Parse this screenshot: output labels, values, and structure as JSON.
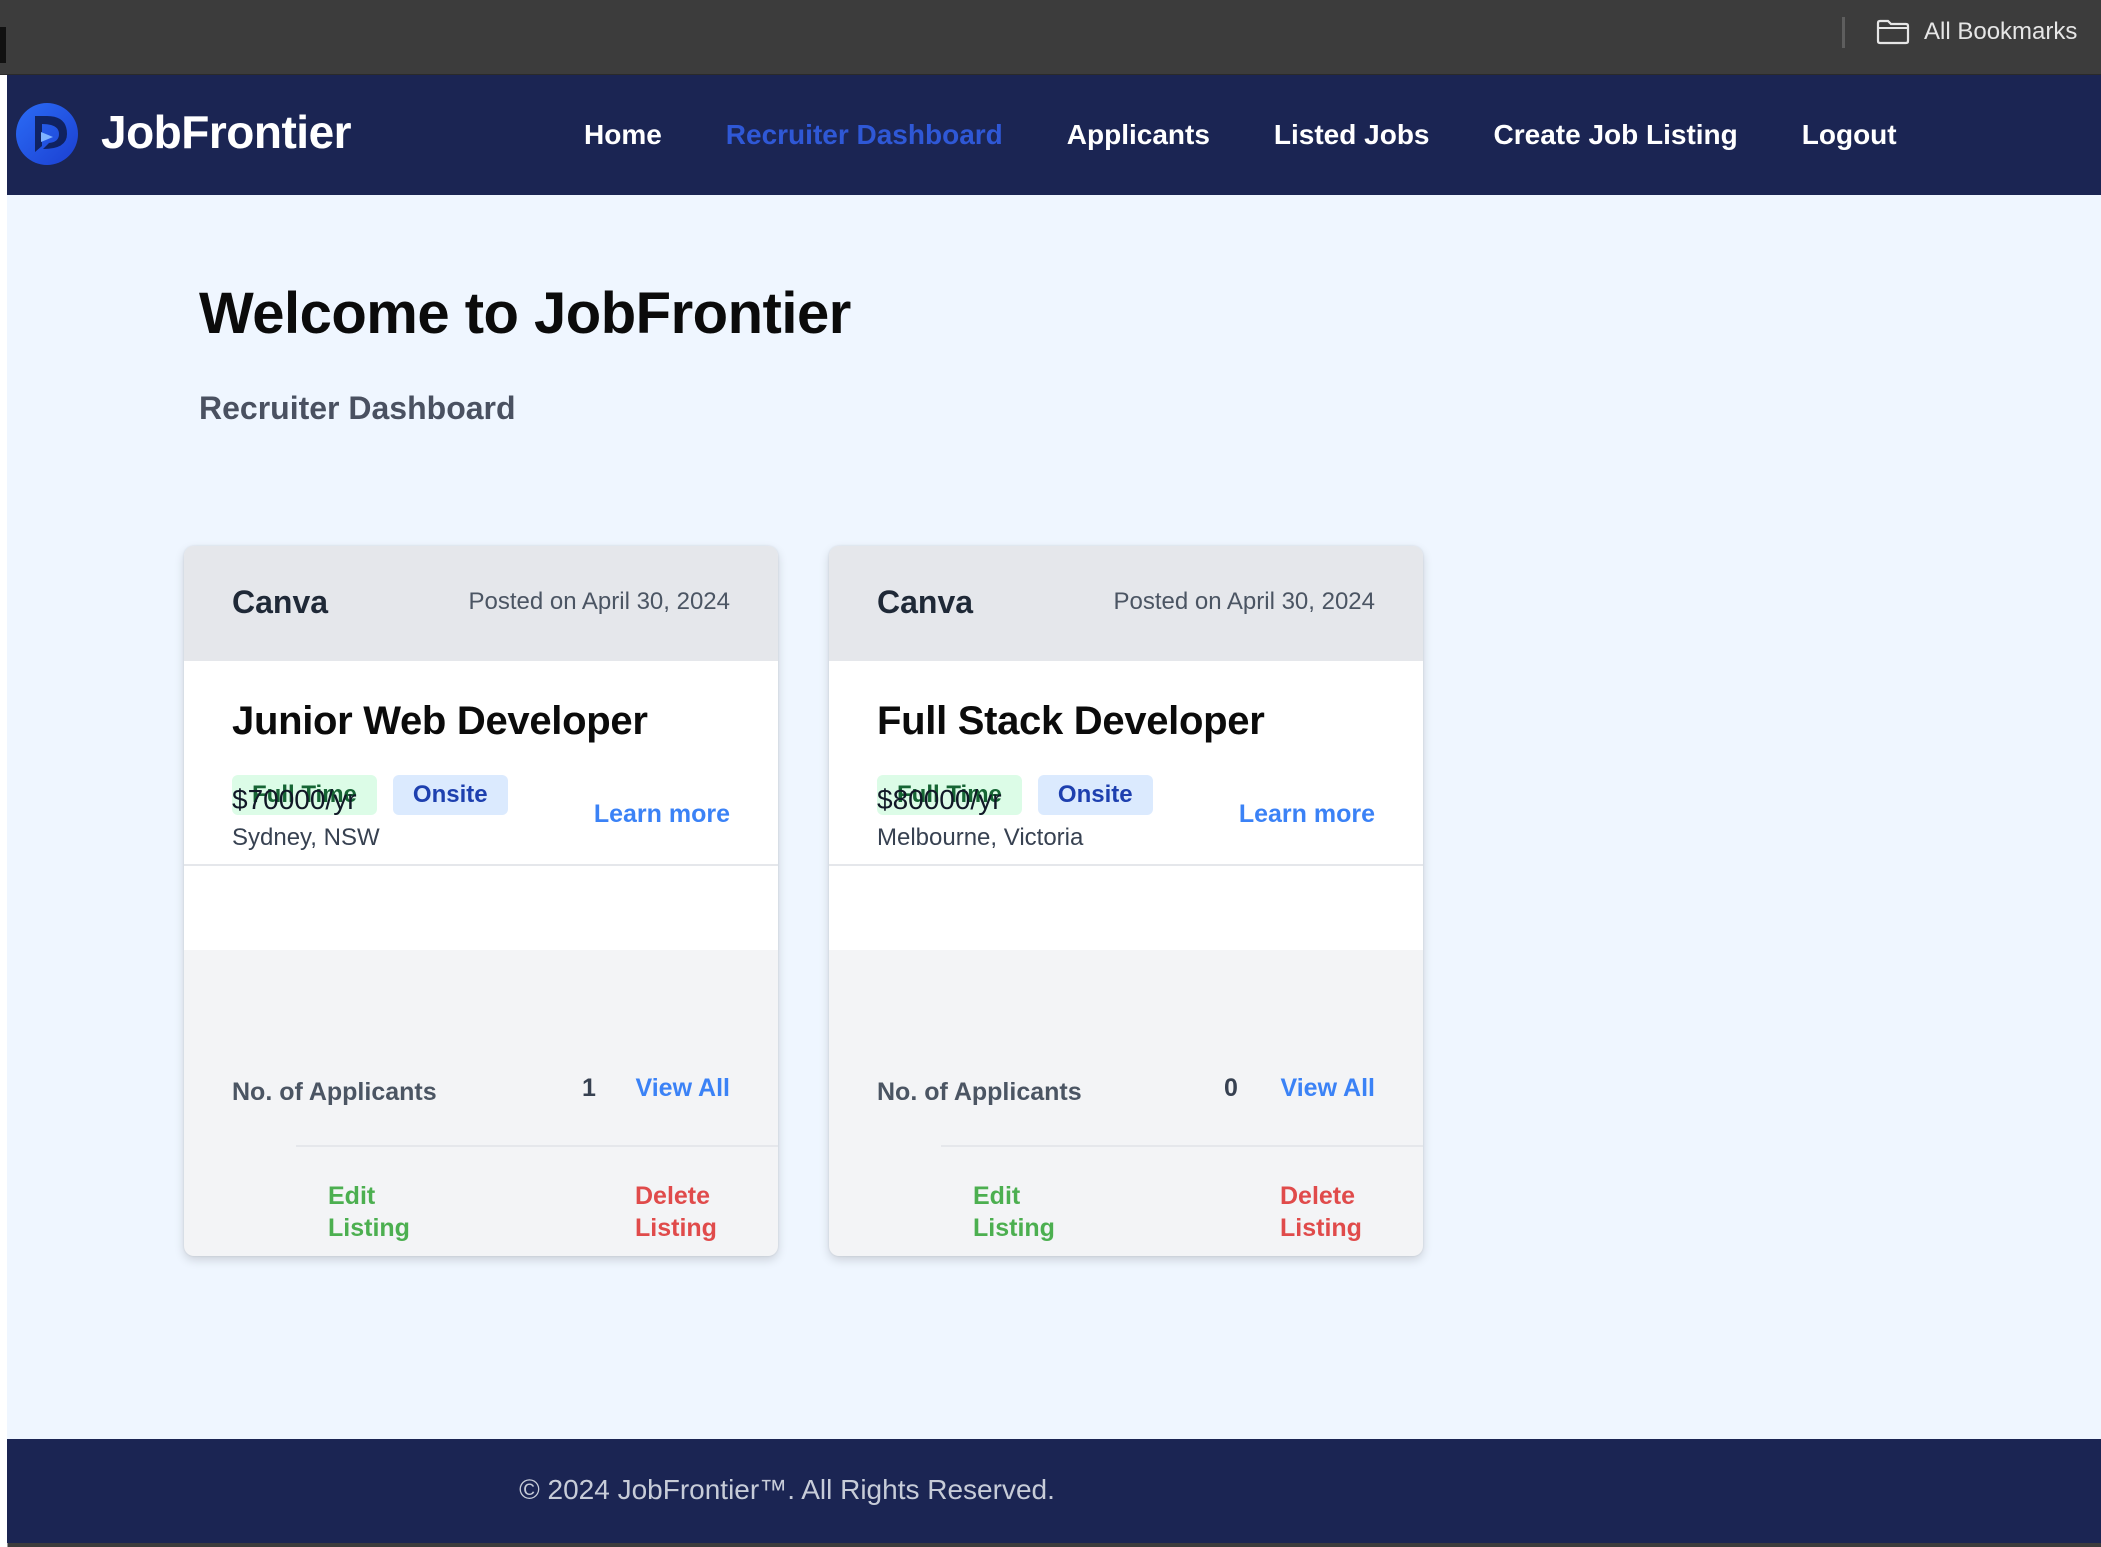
{
  "browser": {
    "bookmarks_label": "All Bookmarks"
  },
  "navbar": {
    "brand": "JobFrontier",
    "links": [
      {
        "label": "Home",
        "active": false
      },
      {
        "label": "Recruiter Dashboard",
        "active": true
      },
      {
        "label": "Applicants",
        "active": false
      },
      {
        "label": "Listed Jobs",
        "active": false
      },
      {
        "label": "Create Job Listing",
        "active": false
      },
      {
        "label": "Logout",
        "active": false
      }
    ]
  },
  "main": {
    "title": "Welcome to JobFrontier",
    "subtitle": "Recruiter Dashboard"
  },
  "jobs": [
    {
      "company": "Canva",
      "posted": "Posted on April 30, 2024",
      "title": "Junior Web Developer",
      "tags": [
        "Full Time",
        "Onsite"
      ],
      "salary": "$70000/yr",
      "location": "Sydney, NSW",
      "learn_more": "Learn more",
      "applicants_label": "No. of Applicants",
      "applicants_count": "1",
      "view_all": "View All",
      "edit": "Edit Listing",
      "delete": "Delete Listing"
    },
    {
      "company": "Canva",
      "posted": "Posted on April 30, 2024",
      "title": "Full Stack Developer",
      "tags": [
        "Full Time",
        "Onsite"
      ],
      "salary": "$80000/yr",
      "location": "Melbourne, Victoria",
      "learn_more": "Learn more",
      "applicants_label": "No. of Applicants",
      "applicants_count": "0",
      "view_all": "View All",
      "edit": "Edit Listing",
      "delete": "Delete Listing"
    }
  ],
  "footer": {
    "copyright": "© 2024 JobFrontier™. All Rights Reserved."
  },
  "colors": {
    "navbar_bg": "#1b2553",
    "page_bg": "#eff6ff",
    "active_link": "#2f58d6",
    "link_blue": "#3b82f6",
    "edit_green": "#4caf50",
    "delete_red": "#e04b4b"
  }
}
